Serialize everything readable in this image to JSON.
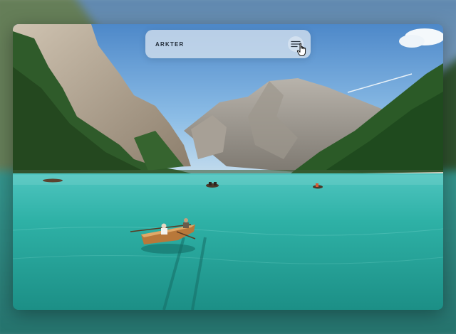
{
  "header": {
    "brand": "ARKTER"
  },
  "icons": {
    "menu": "menu-lines-icon",
    "cursor": "hand-pointer-icon"
  },
  "colors": {
    "menu_bar_bg": "#d6e2ee",
    "brand_text": "#1f2a36",
    "water": "#2bb3a8",
    "sky": "#7fb3e0"
  }
}
